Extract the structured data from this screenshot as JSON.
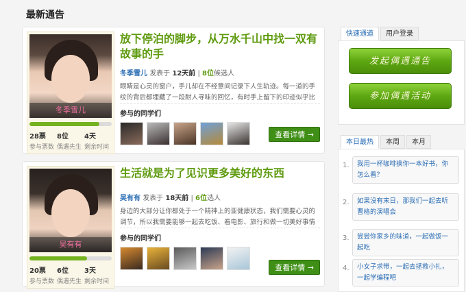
{
  "page": {
    "title": "最新通告"
  },
  "posts": [
    {
      "photo_name": "冬季雪儿",
      "progress": 0.85,
      "stats": [
        {
          "value": "28票",
          "label": "参与票数"
        },
        {
          "value": "8位",
          "label": "偶遇先生"
        },
        {
          "value": "4天",
          "label": "剩余时间"
        }
      ],
      "title": "放下停泊的脚步，从万水千山中找一双有故事的手",
      "author": "冬季雪儿",
      "posted_label": "发表于",
      "time": "12天前",
      "candidates_count": "8位",
      "candidates_label": "候选人",
      "description": "眼睛是心灵的窗户，手儿却在不经意间记录下人生轨迹。每一道的手纹的背后都埋藏了一段耐人寻味的回忆，有时手上留下的印迹似乎比",
      "participants_label": "参与的同学们",
      "detail_button": "查看详情 →"
    },
    {
      "photo_name": "吴有有",
      "progress": 0.7,
      "stats": [
        {
          "value": "20票",
          "label": "参与票数"
        },
        {
          "value": "6位",
          "label": "偶遇先生"
        },
        {
          "value": "3天",
          "label": "剩余时间"
        }
      ],
      "title": "生活就是为了见识更多美好的东西",
      "author": "吴有有",
      "posted_label": "发表于",
      "time": "18天前",
      "candidates_count": "6位",
      "candidates_label": "选人",
      "description": "身边的大部分让你都处于一个精神上的亚健康状态，我们需要心灵的调节，所以我需要能够一起去吃饭、看电影、旅行和做一切美好事情",
      "participants_label": "参与的同学们",
      "detail_button": "查看详情 →"
    }
  ],
  "sidebar": {
    "tabs_top": [
      "快速通道",
      "用户登录"
    ],
    "actions": [
      "发起偶遇通告",
      "参加偶遇活动"
    ],
    "tabs_hot": [
      "本日最热",
      "本周",
      "本月"
    ],
    "hot_items": [
      {
        "num": "1.",
        "text": "我用一杯咖啡换你一本好书，你怎么看？"
      },
      {
        "num": "2.",
        "text": "如果没有末日，那我们一起去听曹格的演唱会"
      },
      {
        "num": "3.",
        "text": "尝尝你家乡的味道，一起做饭一起吃"
      },
      {
        "num": "4.",
        "text": "小女子求带，一起去拯救小扎，一起学编程吧"
      }
    ]
  },
  "colors": {
    "accent": "#5f9b10",
    "button": "#3f8f16",
    "link": "#2a6db4"
  }
}
